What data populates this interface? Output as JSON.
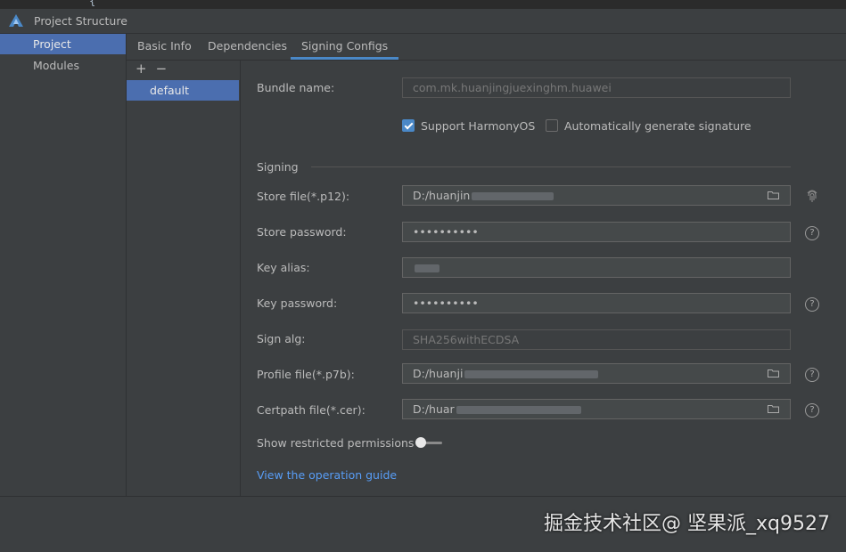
{
  "window": {
    "title": "Project Structure"
  },
  "nav": {
    "items": [
      {
        "label": "Project"
      },
      {
        "label": "Modules"
      }
    ]
  },
  "tabs": [
    {
      "label": "Basic Info"
    },
    {
      "label": "Dependencies"
    },
    {
      "label": "Signing Configs"
    }
  ],
  "configs": {
    "add": "+",
    "remove": "−",
    "items": [
      {
        "label": "default"
      }
    ]
  },
  "form": {
    "bundle_name": {
      "label": "Bundle name:",
      "value": "com.mk.huanjingjuexinghm.huawei"
    },
    "support_harmonyos": {
      "label": "Support HarmonyOS",
      "checked": true
    },
    "auto_signature": {
      "label": "Automatically generate signature",
      "checked": false
    },
    "section_title": "Signing",
    "store_file": {
      "label": "Store file(*.p12):",
      "value": "D:/huanjin"
    },
    "store_password": {
      "label": "Store password:",
      "value": "••••••••••"
    },
    "key_alias": {
      "label": "Key alias:",
      "value": ""
    },
    "key_password": {
      "label": "Key password:",
      "value": "••••••••••"
    },
    "sign_alg": {
      "label": "Sign alg:",
      "value": "SHA256withECDSA"
    },
    "profile_file": {
      "label": "Profile file(*.p7b):",
      "value": "D:/huanji"
    },
    "certpath_file": {
      "label": "Certpath file(*.cer):",
      "value": "D:/huar"
    },
    "show_restricted": {
      "label": "Show restricted permissions",
      "enabled": false
    },
    "guide_link": "View the operation guide",
    "help_glyph": "?"
  },
  "watermark": "掘金技术社区@ 坚果派_xq9527",
  "colors": {
    "accent": "#4a88c7",
    "selection": "#4b6eaf",
    "link": "#589df6",
    "background": "#3c3f41"
  },
  "icons": [
    "harmony-logo-icon",
    "folder-icon",
    "fingerprint-icon",
    "help-icon",
    "add-icon",
    "remove-icon"
  ]
}
